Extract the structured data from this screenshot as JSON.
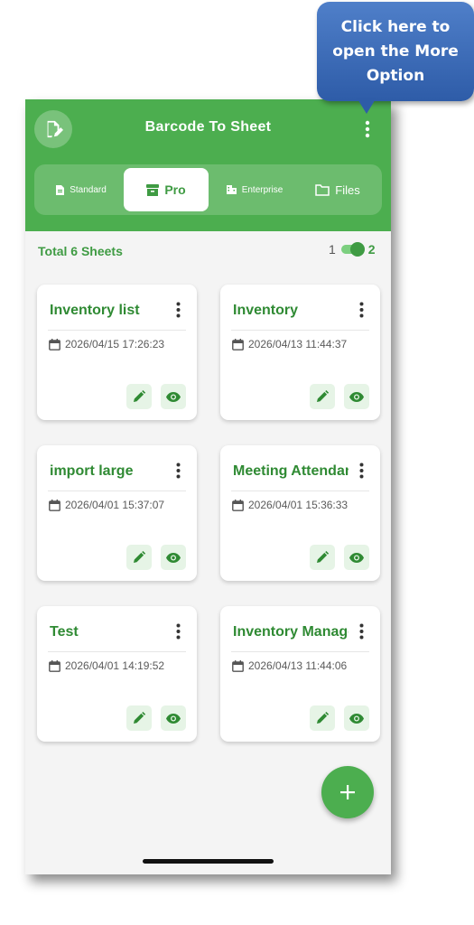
{
  "callout": {
    "line1": "Click here to",
    "line2": "open the More",
    "line3": "Option"
  },
  "appbar": {
    "title": "Barcode To Sheet",
    "logo_icon": "edit-document-icon",
    "more_icon": "more-vert-icon"
  },
  "tabs": [
    {
      "label": "Standard",
      "icon": "document-icon",
      "active": false
    },
    {
      "label": "Pro",
      "icon": "archive-box-icon",
      "active": true
    },
    {
      "label": "Enterprise",
      "icon": "building-icon",
      "active": false
    },
    {
      "label": "Files",
      "icon": "folder-icon",
      "active": false
    }
  ],
  "summary": {
    "total": "Total 6 Sheets",
    "left_num": "1",
    "right_num": "2"
  },
  "sheets": [
    {
      "title": "Inventory list",
      "date": "2026/04/15 17:26:23"
    },
    {
      "title": "Inventory",
      "date": "2026/04/13 11:44:37"
    },
    {
      "title": "import large",
      "date": "2026/04/01 15:37:07"
    },
    {
      "title": "Meeting Attendance",
      "date": "2026/04/01 15:36:33"
    },
    {
      "title": "Test",
      "date": "2026/04/01 14:19:52"
    },
    {
      "title": "Inventory Management",
      "date": "2026/04/13 11:44:06"
    }
  ],
  "fab": {
    "icon": "plus-icon"
  },
  "colors": {
    "primary": "#4cae4f",
    "primary_dark": "#2f8a33",
    "callout": "#3a68b4",
    "action_bg": "#e6f4e6"
  }
}
